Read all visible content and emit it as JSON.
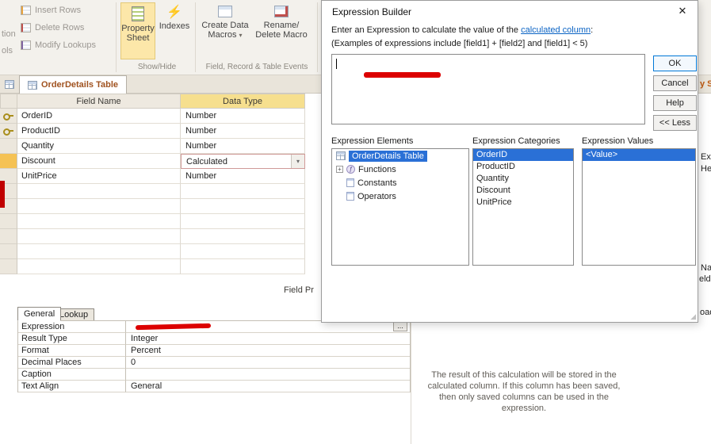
{
  "colors": {
    "selection_blue": "#2a70d6",
    "header_highlight": "#f6df8e",
    "redaction_red": "#dc0000",
    "tab_text_orange": "#a0521f",
    "ok_border_blue": "#0078d7",
    "ribbon_bg": "#f3f1ec"
  },
  "icons": {
    "dropdown_arrow": "▾",
    "lightning": "⚡",
    "close": "✕",
    "plus": "+",
    "fx": "ƒ",
    "grip": "◢"
  },
  "ribbon": {
    "fragment_top": "tion",
    "fragment_bottom": "ols",
    "insert_rows": "Insert Rows",
    "delete_rows": "Delete Rows",
    "modify_lookups": "Modify Lookups",
    "property_sheet_line1": "Property",
    "property_sheet_line2": "Sheet",
    "indexes": "Indexes",
    "create_data_line1": "Create Data",
    "create_data_line2": "Macros",
    "rename_line1": "Rename/",
    "rename_line2": "Delete Macro",
    "group_show_hide": "Show/Hide",
    "group_events": "Field, Record & Table Events"
  },
  "tabbar": {
    "object_tab": "OrderDetails Table"
  },
  "grid": {
    "col_field_name": "Field Name",
    "col_data_type": "Data Type",
    "rows": [
      {
        "name": "OrderID",
        "type": "Number"
      },
      {
        "name": "ProductID",
        "type": "Number"
      },
      {
        "name": "Quantity",
        "type": "Number"
      },
      {
        "name": "Discount",
        "type": "Calculated"
      },
      {
        "name": "UnitPrice",
        "type": "Number"
      }
    ],
    "field_properties_fragment": "Field Pr"
  },
  "properties": {
    "tab_general": "General",
    "tab_lookup": "Lookup",
    "rows": [
      {
        "label": "Expression",
        "value": ""
      },
      {
        "label": "Result Type",
        "value": "Integer"
      },
      {
        "label": "Format",
        "value": "Percent"
      },
      {
        "label": "Decimal Places",
        "value": "0"
      },
      {
        "label": "Caption",
        "value": ""
      },
      {
        "label": "Text Align",
        "value": "General"
      }
    ],
    "builder_button": "...",
    "help_text": "The result of this calculation will be stored in the calculated column. If this column has been saved, then only saved columns can be used in the expression."
  },
  "dialog": {
    "title": "Expression Builder",
    "instruction_prefix": "Enter an Expression to calculate the value of the ",
    "instruction_link": "calculated column",
    "instruction_suffix": ":",
    "examples": "(Examples of expressions include [field1] + [field2] and [field1] < 5)",
    "ok": "OK",
    "cancel": "Cancel",
    "help": "Help",
    "less": "<< Less",
    "elements_label": "Expression Elements",
    "categories_label": "Expression Categories",
    "values_label": "Expression Values",
    "elements": [
      {
        "label": "OrderDetails Table"
      },
      {
        "label": "Functions"
      },
      {
        "label": "Constants"
      },
      {
        "label": "Operators"
      }
    ],
    "categories": [
      {
        "label": "OrderID"
      },
      {
        "label": "ProductID"
      },
      {
        "label": "Quantity"
      },
      {
        "label": "Discount"
      },
      {
        "label": "UnitPrice"
      }
    ],
    "values": [
      {
        "label": "<Value>"
      }
    ]
  },
  "edge_fragments": {
    "tab_right": "y S",
    "f1": "Exp",
    "f2": "He",
    "f3": "Na",
    "f4": "elds",
    "f5": "oad"
  }
}
